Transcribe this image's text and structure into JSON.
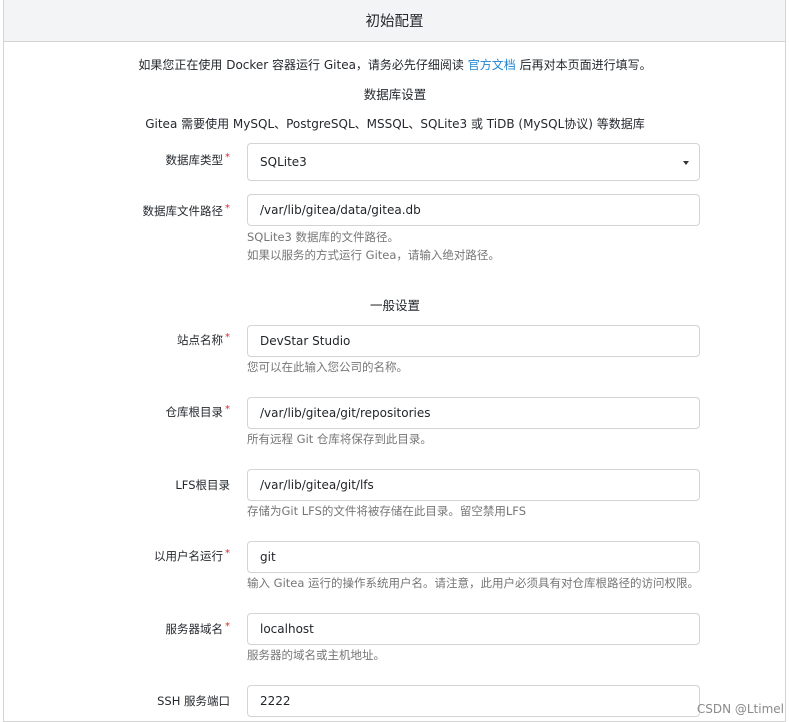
{
  "header": {
    "title": "初始配置"
  },
  "intro": {
    "before": "如果您正在使用 Docker 容器运行 Gitea，请务必先仔细阅读 ",
    "link": "官方文档",
    "after": " 后再对本页面进行填写。"
  },
  "db_section": {
    "title": "数据库设置",
    "desc": "Gitea 需要使用 MySQL、PostgreSQL、MSSQL、SQLite3 或 TiDB (MySQL协议) 等数据库",
    "db_type": {
      "label": "数据库类型",
      "value": "SQLite3"
    },
    "db_path": {
      "label": "数据库文件路径",
      "value": "/var/lib/gitea/data/gitea.db",
      "help1": "SQLite3 数据库的文件路径。",
      "help2": "如果以服务的方式运行 Gitea，请输入绝对路径。"
    }
  },
  "general_section": {
    "title": "一般设置",
    "site_name": {
      "label": "站点名称",
      "value": "DevStar Studio",
      "help": "您可以在此输入您公司的名称。"
    },
    "repo_root": {
      "label": "仓库根目录",
      "value": "/var/lib/gitea/git/repositories",
      "help": "所有远程 Git 仓库将保存到此目录。"
    },
    "lfs_root": {
      "label": "LFS根目录",
      "value": "/var/lib/gitea/git/lfs",
      "help": "存储为Git LFS的文件将被存储在此目录。留空禁用LFS"
    },
    "run_user": {
      "label": "以用户名运行",
      "value": "git",
      "help": "输入 Gitea 运行的操作系统用户名。请注意，此用户必须具有对仓库根路径的访问权限。"
    },
    "domain": {
      "label": "服务器域名",
      "value": "localhost",
      "help": "服务器的域名或主机地址。"
    },
    "ssh_port": {
      "label": "SSH 服务端口",
      "value": "2222"
    }
  },
  "required_mark": "*",
  "watermark": "CSDN @Ltimel"
}
